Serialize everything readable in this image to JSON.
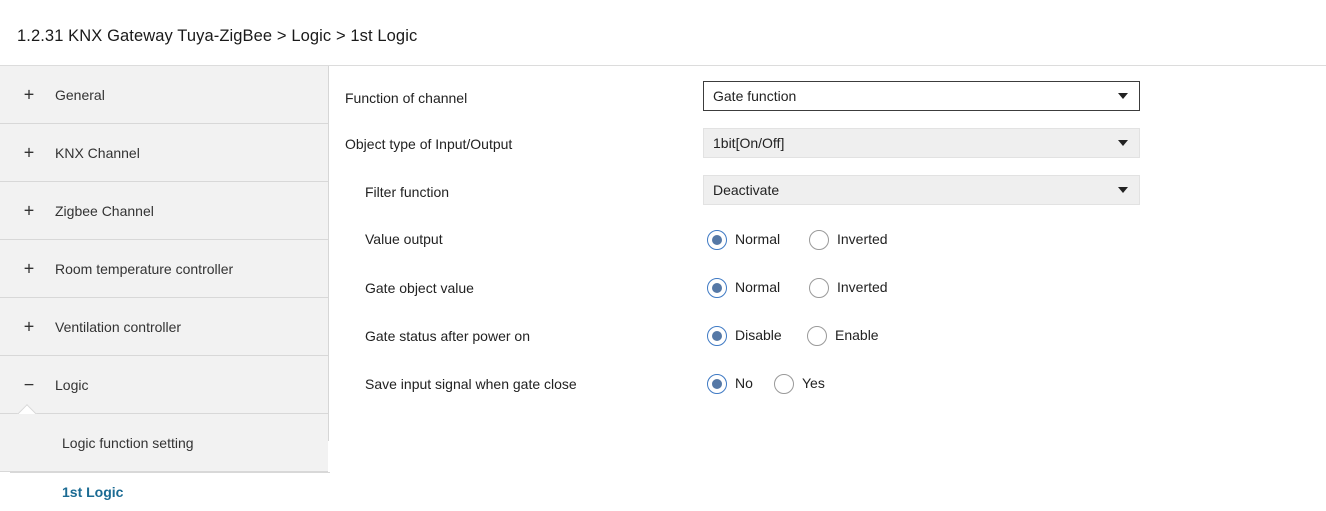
{
  "header": {
    "title": "1.2.31 KNX Gateway Tuya-ZigBee > Logic > 1st Logic"
  },
  "sidebar": {
    "items": [
      {
        "sign": "+",
        "label": "General"
      },
      {
        "sign": "+",
        "label": "KNX Channel"
      },
      {
        "sign": "+",
        "label": "Zigbee Channel"
      },
      {
        "sign": "+",
        "label": "Room temperature controller"
      },
      {
        "sign": "+",
        "label": "Ventilation controller"
      },
      {
        "sign": "−",
        "label": "Logic"
      }
    ],
    "sub_items": [
      {
        "label": "Logic function setting"
      },
      {
        "label": "1st Logic"
      }
    ]
  },
  "params": {
    "function_of_channel": {
      "label": "Function of channel",
      "value": "Gate function"
    },
    "object_type": {
      "label": "Object type of Input/Output",
      "value": "1bit[On/Off]"
    },
    "filter_function": {
      "label": "Filter function",
      "value": "Deactivate"
    },
    "value_output": {
      "label": "Value output",
      "options": [
        "Normal",
        "Inverted"
      ],
      "selected": "Normal"
    },
    "gate_object_value": {
      "label": "Gate object value",
      "options": [
        "Normal",
        "Inverted"
      ],
      "selected": "Normal"
    },
    "gate_status_power_on": {
      "label": "Gate status after power on",
      "options": [
        "Disable",
        "Enable"
      ],
      "selected": "Disable"
    },
    "save_input_signal": {
      "label": "Save input signal when gate close",
      "options": [
        "No",
        "Yes"
      ],
      "selected": "No"
    }
  },
  "colors": {
    "active_text": "#1b6b93",
    "radio_fill": "#5578a6",
    "sidebar_bg": "#f2f2f2"
  }
}
